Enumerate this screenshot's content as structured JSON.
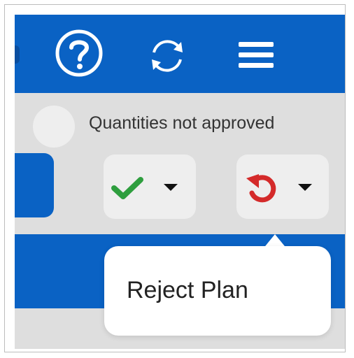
{
  "toolbar": {
    "help_icon": "help-circle",
    "sync_icon": "sync-arrows",
    "menu_icon": "hamburger-menu"
  },
  "status": {
    "text": "Quantities not approved"
  },
  "actions": {
    "approve_icon": "checkmark",
    "reject_icon": "undo-arrow",
    "dropdown_icon": "caret-down"
  },
  "tooltip": {
    "text": "Reject Plan"
  },
  "colors": {
    "brand_blue": "#0a62c4",
    "approve_green": "#2e9e3e",
    "reject_red": "#d42a2a",
    "surface_gray": "#dedede",
    "button_gray": "#eeeeee"
  }
}
